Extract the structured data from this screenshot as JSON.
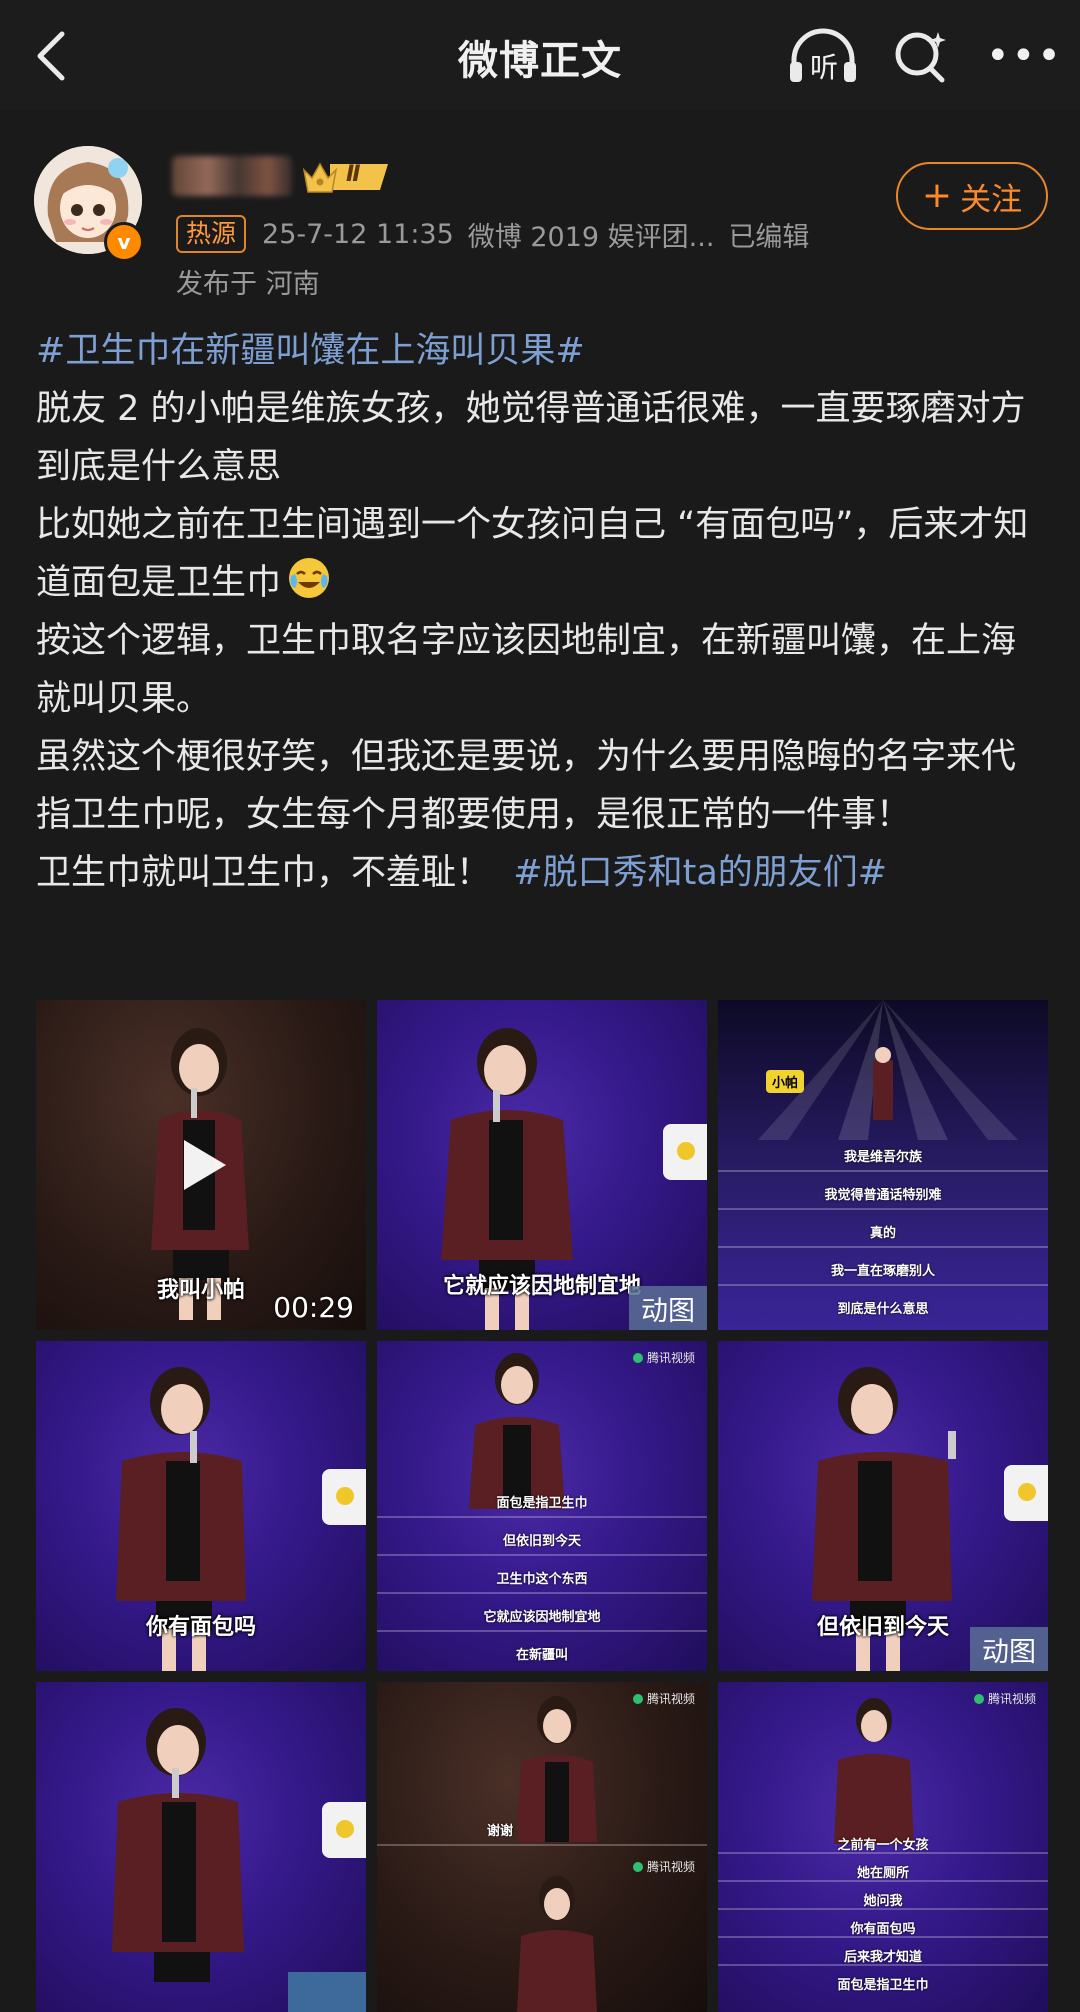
{
  "nav": {
    "title": "微博正文",
    "listen_label": "听",
    "more_label": "•••"
  },
  "author": {
    "level": "Ⅱ",
    "verified_mark": "v",
    "hot_tag": "热源",
    "date": "25-7-12 11:35",
    "source": "微博 2019 娱评团...",
    "edited": "已编辑",
    "location": "发布于 河南",
    "follow_label": "关注",
    "follow_plus": "+"
  },
  "post": {
    "hashtag_1": "#卫生巾在新疆叫馕在上海叫贝果#",
    "para_1": "脱友 2 的小帕是维族女孩，她觉得普通话很难，一直要琢磨对方到底是什么意思",
    "para_2": "比如她之前在卫生间遇到一个女孩问自己 “有面包吗”，后来才知道面包是卫生巾",
    "para_3": "按这个逻辑，卫生巾取名字应该因地制宜，在新疆叫馕，在上海就叫贝果。",
    "para_4": "虽然这个梗很好笑，但我还是要说，为什么要用隐晦的名字来代指卫生巾呢，女生每个月都要使用，是很正常的一件事！",
    "para_5": "卫生巾就叫卫生巾，不羞耻！",
    "hashtag_2": "#脱口秀和ta的朋友们#"
  },
  "images": {
    "video": {
      "subtitle": "我叫小帕",
      "duration": "00:29"
    },
    "img2": {
      "subtitle": "它就应该因地制宜地",
      "badge": "动图"
    },
    "img3": {
      "name_tag": "小帕",
      "lines": [
        "我是维吾尔族",
        "我觉得普通话特别难",
        "真的",
        "我一直在琢磨别人",
        "到底是什么意思"
      ]
    },
    "img4": {
      "subtitle": "你有面包吗"
    },
    "img5": {
      "watermark": "腾讯视频",
      "lines": [
        "面包是指卫生巾",
        "但依旧到今天",
        "卫生巾这个东西",
        "它就应该因地制宜地",
        "在新疆叫"
      ]
    },
    "img6": {
      "subtitle": "但依旧到今天",
      "badge": "动图"
    },
    "img8": {
      "watermark": "腾讯视频",
      "top_caption": "谢谢",
      "bottom_watermark": "腾讯视频"
    },
    "img9": {
      "watermark": "腾讯视频",
      "lines": [
        "之前有一个女孩",
        "她在厕所",
        "她问我",
        "你有面包吗",
        "后来我才知道",
        "面包是指卫生巾"
      ]
    }
  },
  "colors": {
    "background": "#1a1a1a",
    "hashtag": "#7e9fd2",
    "accent_orange": "#ff8a2a"
  },
  "icons": [
    "back-arrow-icon",
    "listen-icon",
    "search-icon",
    "more-icon",
    "play-icon",
    "verified-icon",
    "crown-icon"
  ]
}
